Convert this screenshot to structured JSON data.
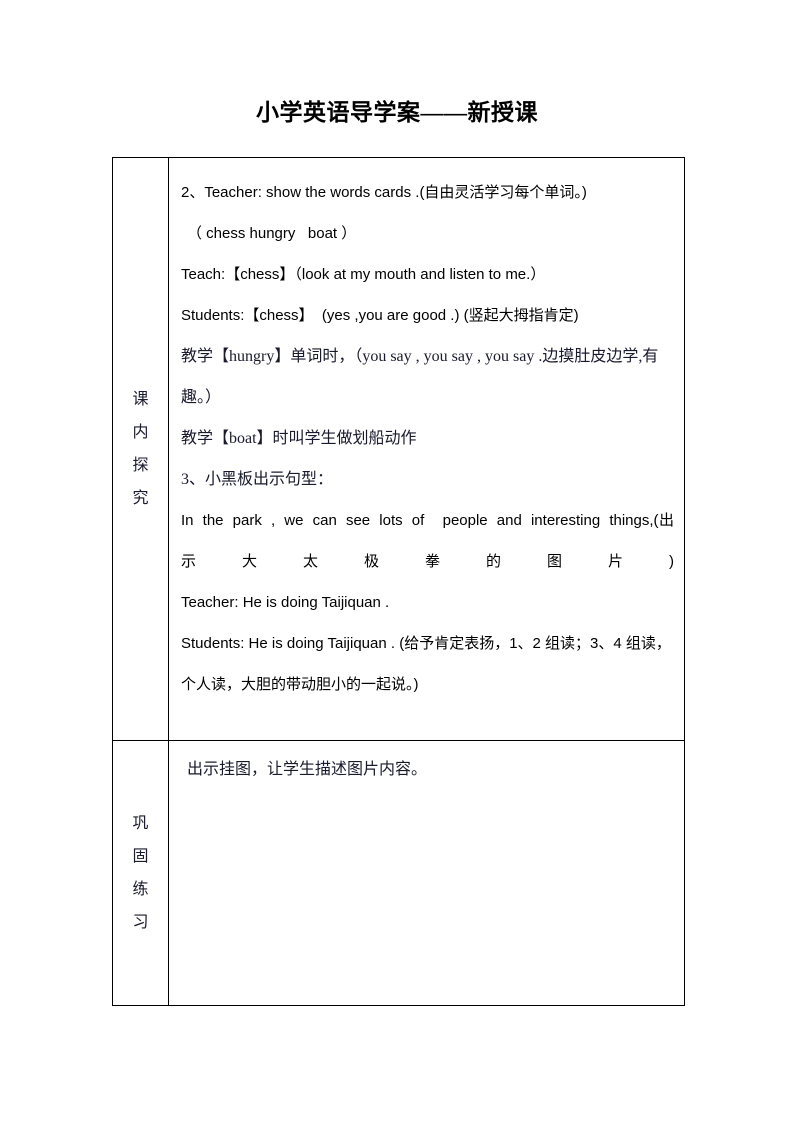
{
  "document": {
    "title": "小学英语导学案——新授课"
  },
  "table": {
    "rows": [
      {
        "label": "课内探究",
        "label_chars": [
          "课",
          "内",
          "探",
          "究"
        ],
        "lines": [
          {
            "text": "2、Teacher: show the words cards .(自由灵活学习每个单词。)",
            "style": "mixed"
          },
          {
            "text": "（ chess hungry   boat ）",
            "style": "mixed-indent"
          },
          {
            "text": "Teach:【chess】（look at my mouth and listen to me.）",
            "style": "mixed"
          },
          {
            "text": "Students:【chess】  (yes ,you are good .) (竖起大拇指肯定)",
            "style": "mixed"
          },
          {
            "text": "教学【hungry】单词时，（you say , you say , you say .边摸肚皮边学,有趣。）",
            "style": "cn"
          },
          {
            "text": "教学【boat】时叫学生做划船动作",
            "style": "cn"
          },
          {
            "text": "3、小黑板出示句型：",
            "style": "cn"
          },
          {
            "text": "In the park , we can see lots of  people and interesting things,(出示大太极拳的图片)",
            "style": "justify-first"
          },
          {
            "text": "Teacher: He is doing Taijiquan .",
            "style": "mixed"
          },
          {
            "text": "Students: He is doing Taijiquan . (给予肯定表扬，1、2 组读；3、4 组读，个人读，大胆的带动胆小的一起说。)",
            "style": "mixed"
          }
        ]
      },
      {
        "label": "巩固练习",
        "label_chars": [
          "巩",
          "固",
          "练",
          "习"
        ],
        "lines": [
          {
            "text": "出示挂图，让学生描述图片内容。",
            "style": "cn"
          }
        ]
      }
    ]
  },
  "colors": {
    "text": "#000000",
    "cjk_text": "#1a1a2e",
    "border": "#000000",
    "background": "#ffffff"
  }
}
